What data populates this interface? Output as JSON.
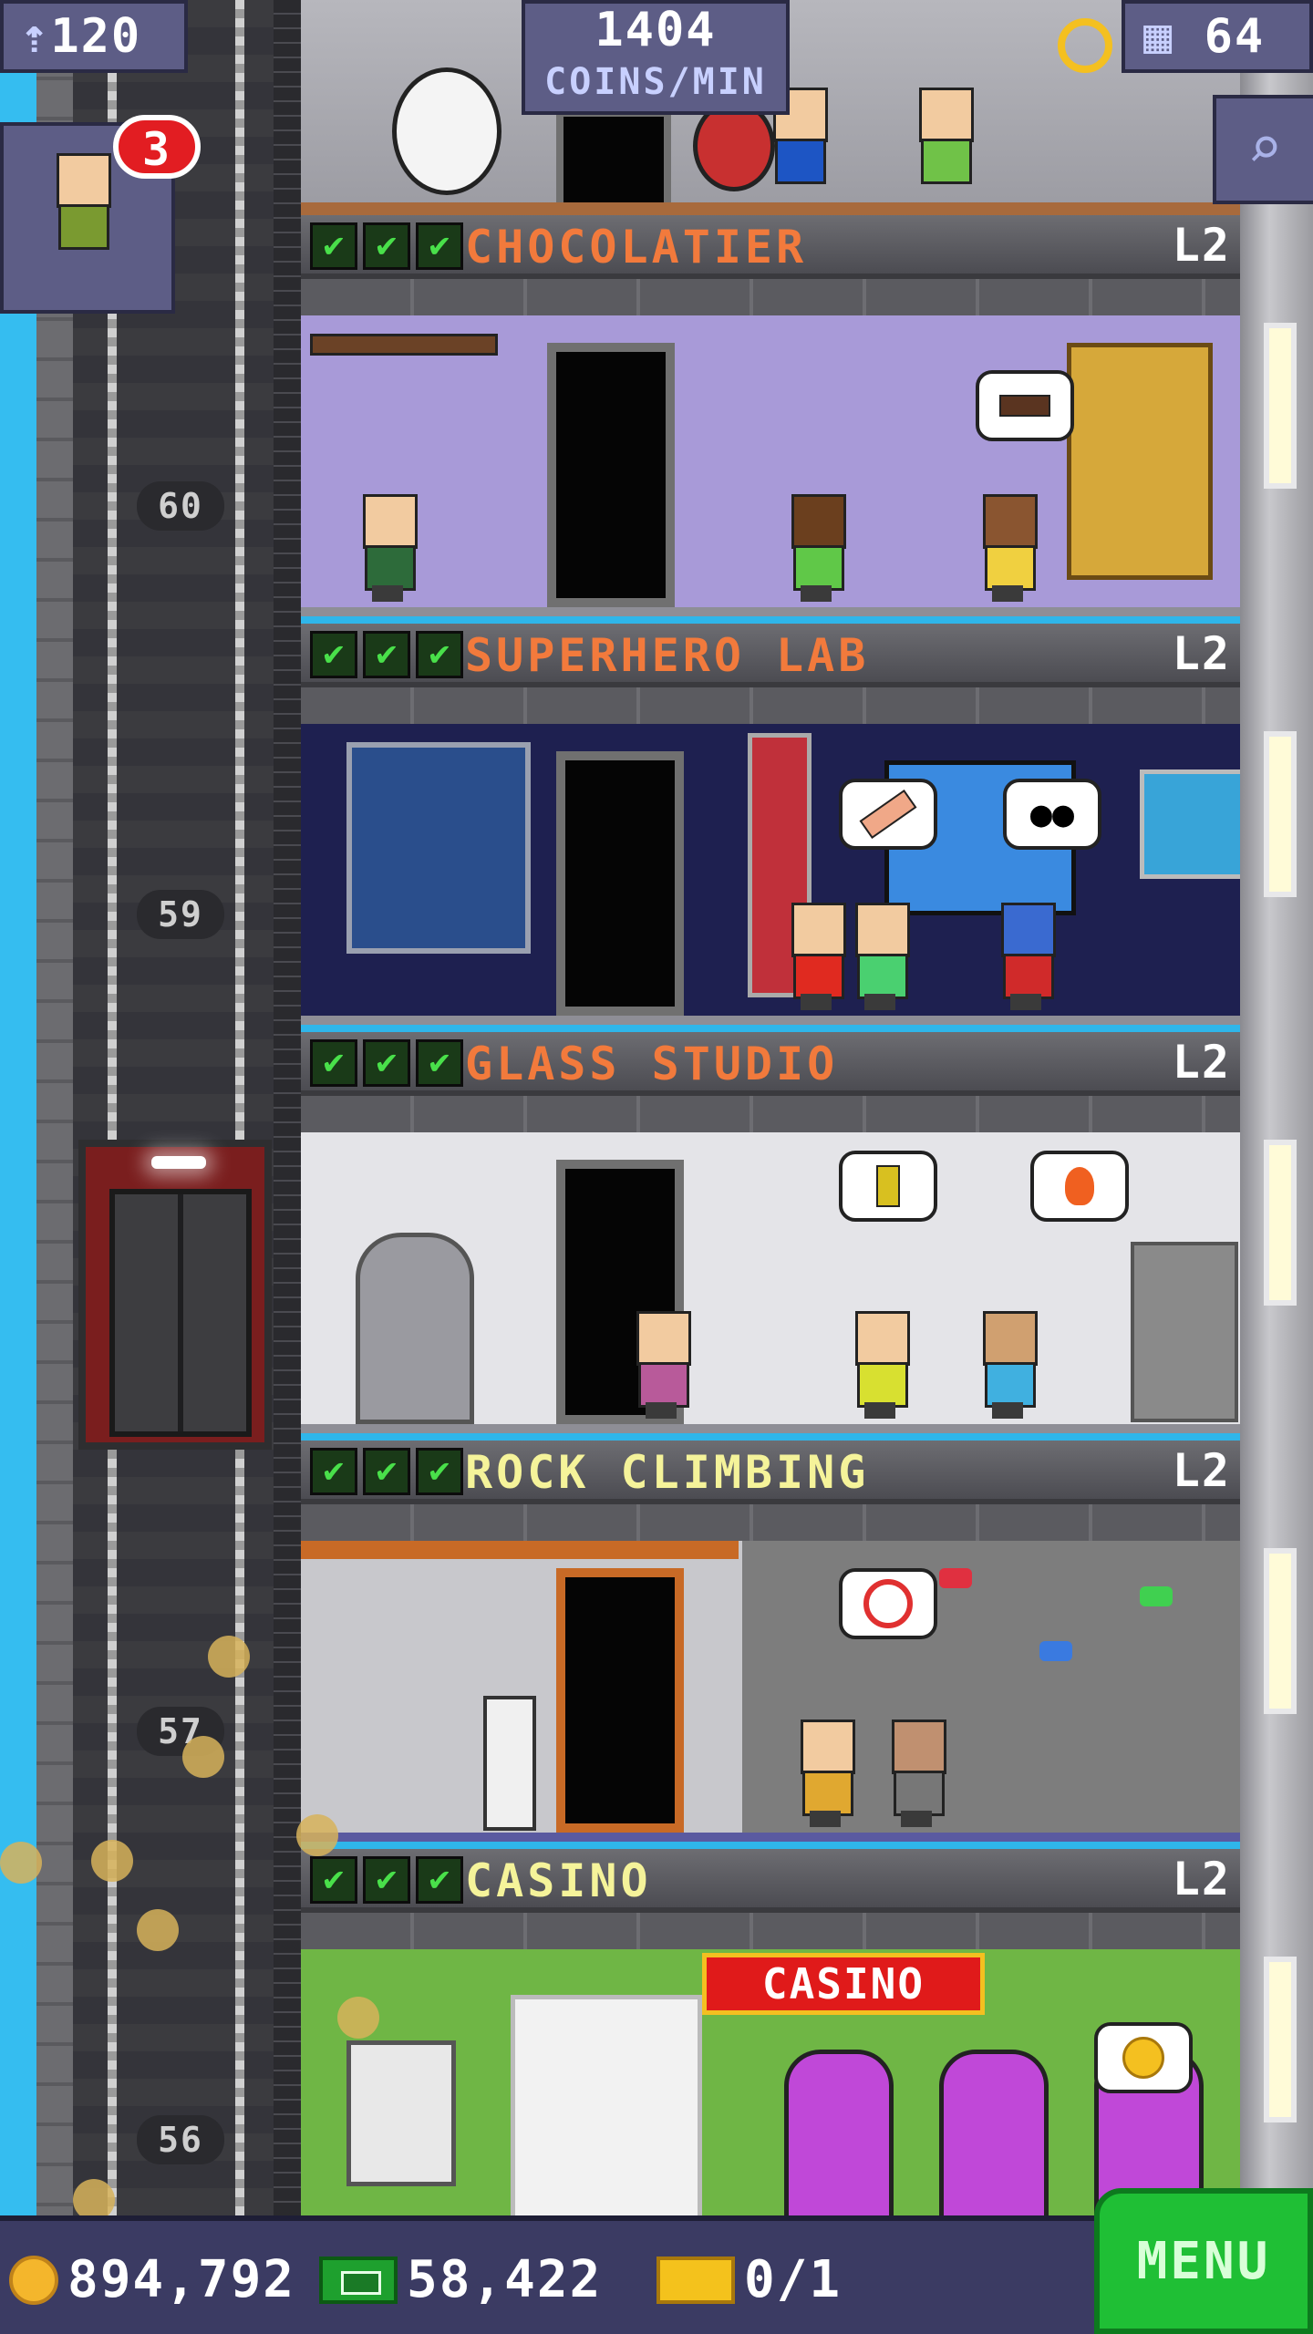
{
  "top_bar": {
    "population": "120",
    "coins_per_min": "1404",
    "coins_per_min_label": "COINS/MIN",
    "floor_count": "64"
  },
  "visitor": {
    "badge_count": "3"
  },
  "floor_numbers": [
    "60",
    "59",
    "57",
    "56"
  ],
  "floors": [
    {
      "name": "CHOCOLATIER",
      "level": "L2",
      "title_color": "#f27a3c",
      "room_bg": "#a89ad8"
    },
    {
      "name": "SUPERHERO LAB",
      "level": "L2",
      "title_color": "#f27a3c",
      "room_bg": "#1e2050"
    },
    {
      "name": "GLASS STUDIO",
      "level": "L2",
      "title_color": "#f27a3c",
      "room_bg": "#e4e4e8"
    },
    {
      "name": "ROCK CLIMBING",
      "level": "L2",
      "title_color": "#f5f39a",
      "room_bg": "#8d8d8d"
    },
    {
      "name": "CASINO",
      "level": "L2",
      "title_color": "#f5f39a",
      "room_bg": "#6fb645"
    }
  ],
  "casino_sign": "CASINO",
  "bottom_bar": {
    "coins": "894,792",
    "bux": "58,422",
    "tickets": "0/1",
    "menu_label": "MENU"
  },
  "colors": {
    "accent_green": "#1fbf35",
    "panel": "#5d5d86",
    "check_green": "#49e04a"
  }
}
